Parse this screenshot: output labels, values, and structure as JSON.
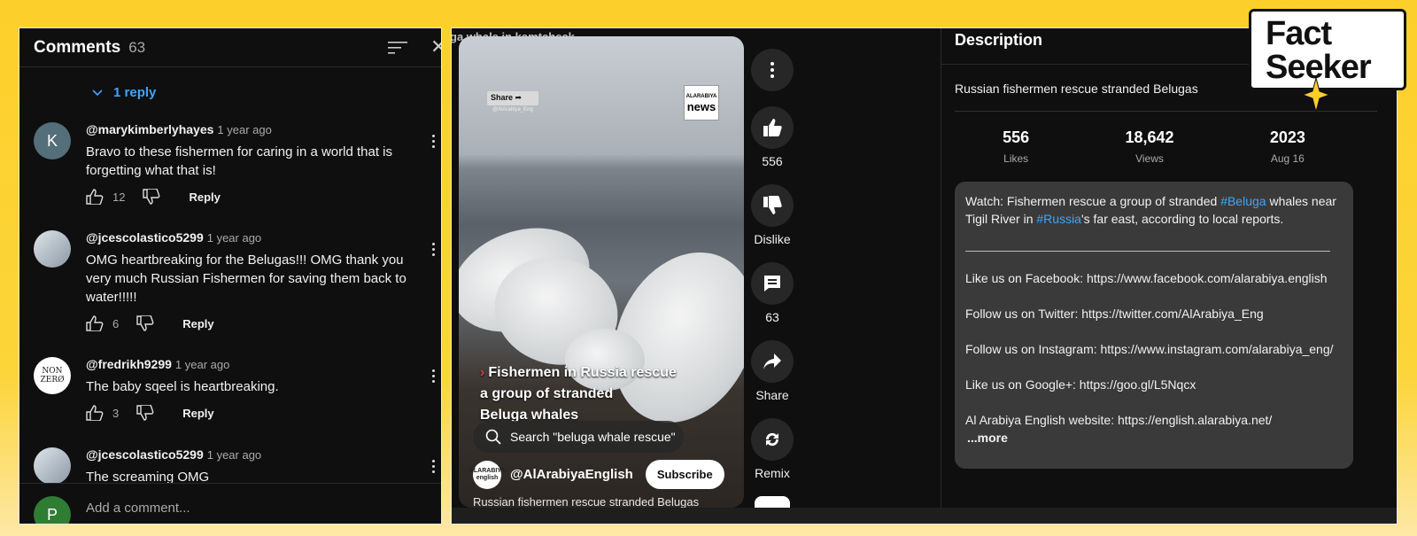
{
  "comments_panel": {
    "title": "Comments",
    "count": "63",
    "replies_toggle": "1 reply",
    "comments": [
      {
        "avatar_letter": "K",
        "handle": "@marykimberlyhayes",
        "age": "1 year ago",
        "text": "Bravo to these fishermen for caring in a world that is forgetting what that is!",
        "likes": "12",
        "reply_label": "Reply"
      },
      {
        "avatar_letter": "",
        "handle": "@jcescolastico5299",
        "age": "1 year ago",
        "text": "OMG heartbreaking for the Belugas!!! OMG thank you very much Russian Fishermen for saving them back to water!!!!!",
        "likes": "6",
        "reply_label": "Reply"
      },
      {
        "avatar_letter": "NON ZERØ",
        "handle": "@fredrikh9299",
        "age": "1 year ago",
        "text": "The baby sqeel is heartbreaking.",
        "likes": "3",
        "reply_label": "Reply"
      },
      {
        "avatar_letter": "",
        "handle": "@jcescolastico5299",
        "age": "1 year ago",
        "text": "The screaming OMG",
        "likes": "",
        "reply_label": ""
      }
    ],
    "add_comment_avatar": "P",
    "add_comment_placeholder": "Add a comment..."
  },
  "video": {
    "title_cut": "ga whale in kamtcheck",
    "share_chip": "Share",
    "share_sub": "@AlArabiya_Eng",
    "news_logo_top": "ALARABIYA",
    "news_logo_main": "news",
    "caption_lines": [
      "Fishermen in Russia rescue",
      "a group of stranded",
      "Beluga whales"
    ],
    "search_text": "Search \"beluga whale rescue\"",
    "channel_avatar_text": "ALARABIYA english",
    "channel_name": "@AlArabiyaEnglish",
    "subscribe_label": "Subscribe",
    "subtitle": "Russian fishermen rescue stranded Belugas"
  },
  "actions": {
    "likes": "556",
    "dislike_label": "Dislike",
    "comments": "63",
    "share_label": "Share",
    "remix_label": "Remix"
  },
  "description": {
    "header": "Description",
    "title": "Russian fishermen rescue stranded Belugas",
    "stats": [
      {
        "value": "556",
        "label": "Likes"
      },
      {
        "value": "18,642",
        "label": "Views"
      },
      {
        "value": "2023",
        "label": "Aug 16"
      }
    ],
    "body_prefix": "Watch: Fishermen rescue a group of stranded ",
    "hashtag1": "#Beluga",
    "body_mid": " whales near Tigil River in ",
    "hashtag2": "#Russia",
    "body_suffix": "'s far east, according to local reports.",
    "links": [
      "Like us on Facebook: https://www.facebook.com/alarabiya.english",
      "Follow us on Twitter: https://twitter.com/AlArabiya_Eng",
      "Follow us on Instagram: https://www.instagram.com/alarabiya_eng/",
      "Like us on Google+: https://goo.gl/L5Nqcx",
      "Al Arabiya English website: https://english.alarabiya.net/"
    ],
    "more_label": "...more"
  },
  "brand": {
    "line1": "Fact",
    "line2": "Seeker",
    "accent": "#fdcf2b",
    "link_color": "#3ea6ff"
  }
}
